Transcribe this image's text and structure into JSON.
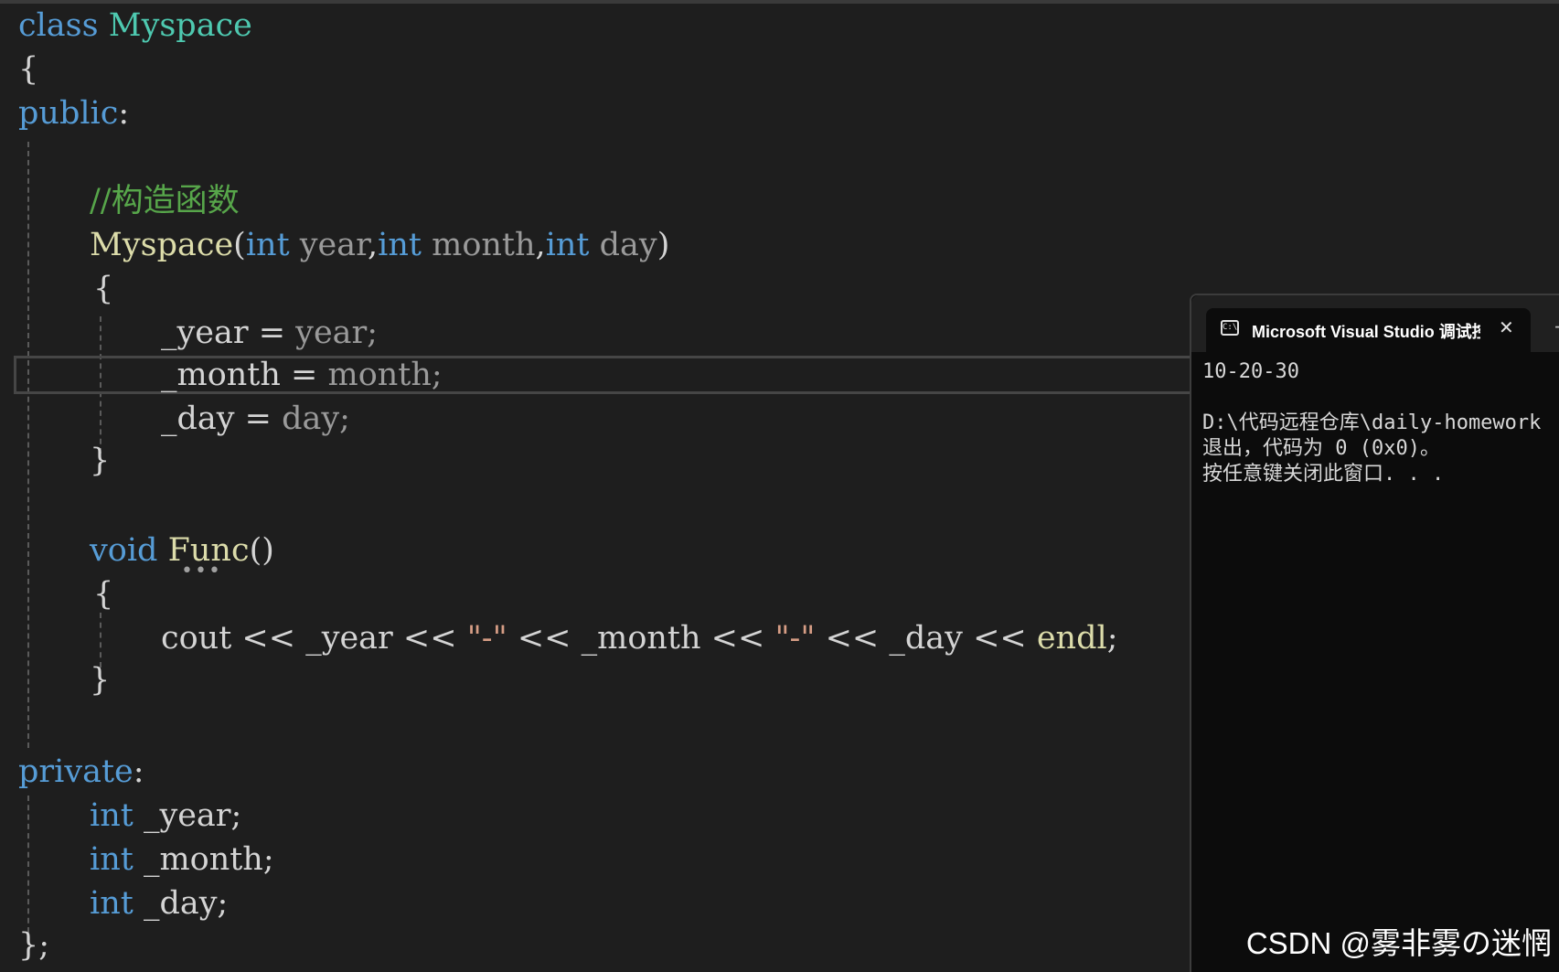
{
  "code": {
    "l1_kw": "class",
    "l1_name": "Myspace",
    "l2": "{",
    "l3_kw": "public",
    "l3_colon": ":",
    "l5_comment": "//构造函数",
    "l6_fn": "Myspace",
    "l6_open": "(",
    "l6_int1": "int",
    "l6_p1": "year",
    "l6_c1": ",",
    "l6_int2": "int",
    "l6_p2": "month",
    "l6_c2": ",",
    "l6_int3": "int",
    "l6_p3": "day",
    "l6_close": ")",
    "l7": "{",
    "l8_member": "_year",
    "l8_eq": " = ",
    "l8_param": "year;",
    "l9_member": "_month",
    "l9_eq": " = ",
    "l9_param": "month;",
    "l10_member": "_day",
    "l10_eq": " = ",
    "l10_param": "day;",
    "l11": "}",
    "l13_kw": "void",
    "l13_fn": "Func",
    "l13_parens": "()",
    "l14": "{",
    "l15_cout": "cout",
    "l15_op1": " << ",
    "l15_m1": "_year",
    "l15_op2": " << ",
    "l15_s1": "\"-\"",
    "l15_op3": " << ",
    "l15_m2": "_month",
    "l15_op4": " << ",
    "l15_s2": "\"-\"",
    "l15_op5": " << ",
    "l15_m3": "_day",
    "l15_op6": " << ",
    "l15_endl": "endl",
    "l15_semi": ";",
    "l16": "}",
    "l18_kw": "private",
    "l18_colon": ":",
    "l19_kw": "int",
    "l19_rest": " _year;",
    "l20_kw": "int",
    "l20_rest": " _month;",
    "l21_kw": "int",
    "l21_rest": " _day;",
    "l22": "};"
  },
  "console": {
    "tab_title": "Microsoft Visual Studio 调试控制台",
    "close_glyph": "✕",
    "new_tab_glyph": "+",
    "icon_glyph": "C:\\",
    "output_line1": "10-20-30",
    "output_line2": "",
    "output_line3": "D:\\代码远程仓库\\daily-homework",
    "output_line4": "退出，代码为 0 (0x0)。",
    "output_line5": "按任意键关闭此窗口. . ."
  },
  "watermark": "CSDN @雾非雾の迷惘",
  "colors": {
    "keyword": "#569cd6",
    "type": "#4ec9b0",
    "function": "#dcdcaa",
    "comment": "#57a64a",
    "parameter": "#9a9a9a",
    "string": "#d69d85",
    "text": "#d4d4d4",
    "background": "#1e1e1e",
    "console_bg": "#0c0c0c"
  },
  "icons": [
    "terminal-icon",
    "close-icon",
    "new-tab-icon"
  ]
}
